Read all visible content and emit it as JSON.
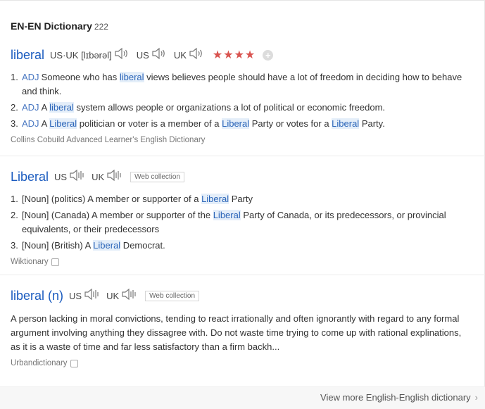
{
  "header": {
    "title": "EN-EN Dictionary",
    "count": "222"
  },
  "colors": {
    "headword": "#1a5bbf",
    "stars": "#d9534f",
    "highlight_bg": "#e4eef9"
  },
  "entry1": {
    "headword": "liberal",
    "phonetic": "US·UK [lɪbərəl]",
    "us": "US",
    "uk": "UK",
    "stars": "★★★★",
    "rating": 4,
    "plus": "+",
    "defs": [
      {
        "num": "1.",
        "pos": "ADJ",
        "pre": "Someone who has ",
        "hl": "liberal",
        "post": " views believes people should have a lot of freedom in deciding how to behave and think."
      },
      {
        "num": "2.",
        "pos": "ADJ",
        "pre": "A ",
        "hl": "liberal",
        "post": " system allows people or organizations a lot of political or economic freedom."
      },
      {
        "num": "3.",
        "pos": "ADJ",
        "pre": "A ",
        "hl": "Liberal",
        "mid1": " politician or voter is a member of a ",
        "hl2": "Liberal",
        "mid2": " Party or votes for a ",
        "hl3": "Liberal",
        "post": " Party."
      }
    ],
    "source": "Collins Cobuild Advanced Learner's English Dictionary"
  },
  "entry2": {
    "headword": "Liberal",
    "us": "US",
    "uk": "UK",
    "tag": "Web collection",
    "defs": [
      {
        "num": "1.",
        "pre": "[Noun] (politics) A member or supporter of a ",
        "hl": "Liberal",
        "post": " Party"
      },
      {
        "num": "2.",
        "pre": "[Noun] (Canada) A member or supporter of the ",
        "hl": "Liberal",
        "post": " Party of Canada, or its predecessors, or provincial equivalents, or their predecessors"
      },
      {
        "num": "3.",
        "pre": "[Noun] (British) A ",
        "hl": "Liberal",
        "post": " Democrat."
      }
    ],
    "source": "Wiktionary"
  },
  "entry3": {
    "headword": "liberal (n)",
    "us": "US",
    "uk": "UK",
    "tag": "Web collection",
    "text": "A person lacking in moral convictions, tending to react irrationally and often ignorantly with regard to any formal argument involving anything they dissagree with. Do not waste time trying to come up with rational explinations, as it is a waste of time and far less satisfactory than a firm backh...",
    "source": "Urbandictionary"
  },
  "footer": {
    "more": "View more English-English dictionary",
    "chevron": "›"
  },
  "icons": {
    "speaker": "speaker-icon",
    "copy": "copy-icon",
    "chevron": "chevron-right-icon"
  }
}
